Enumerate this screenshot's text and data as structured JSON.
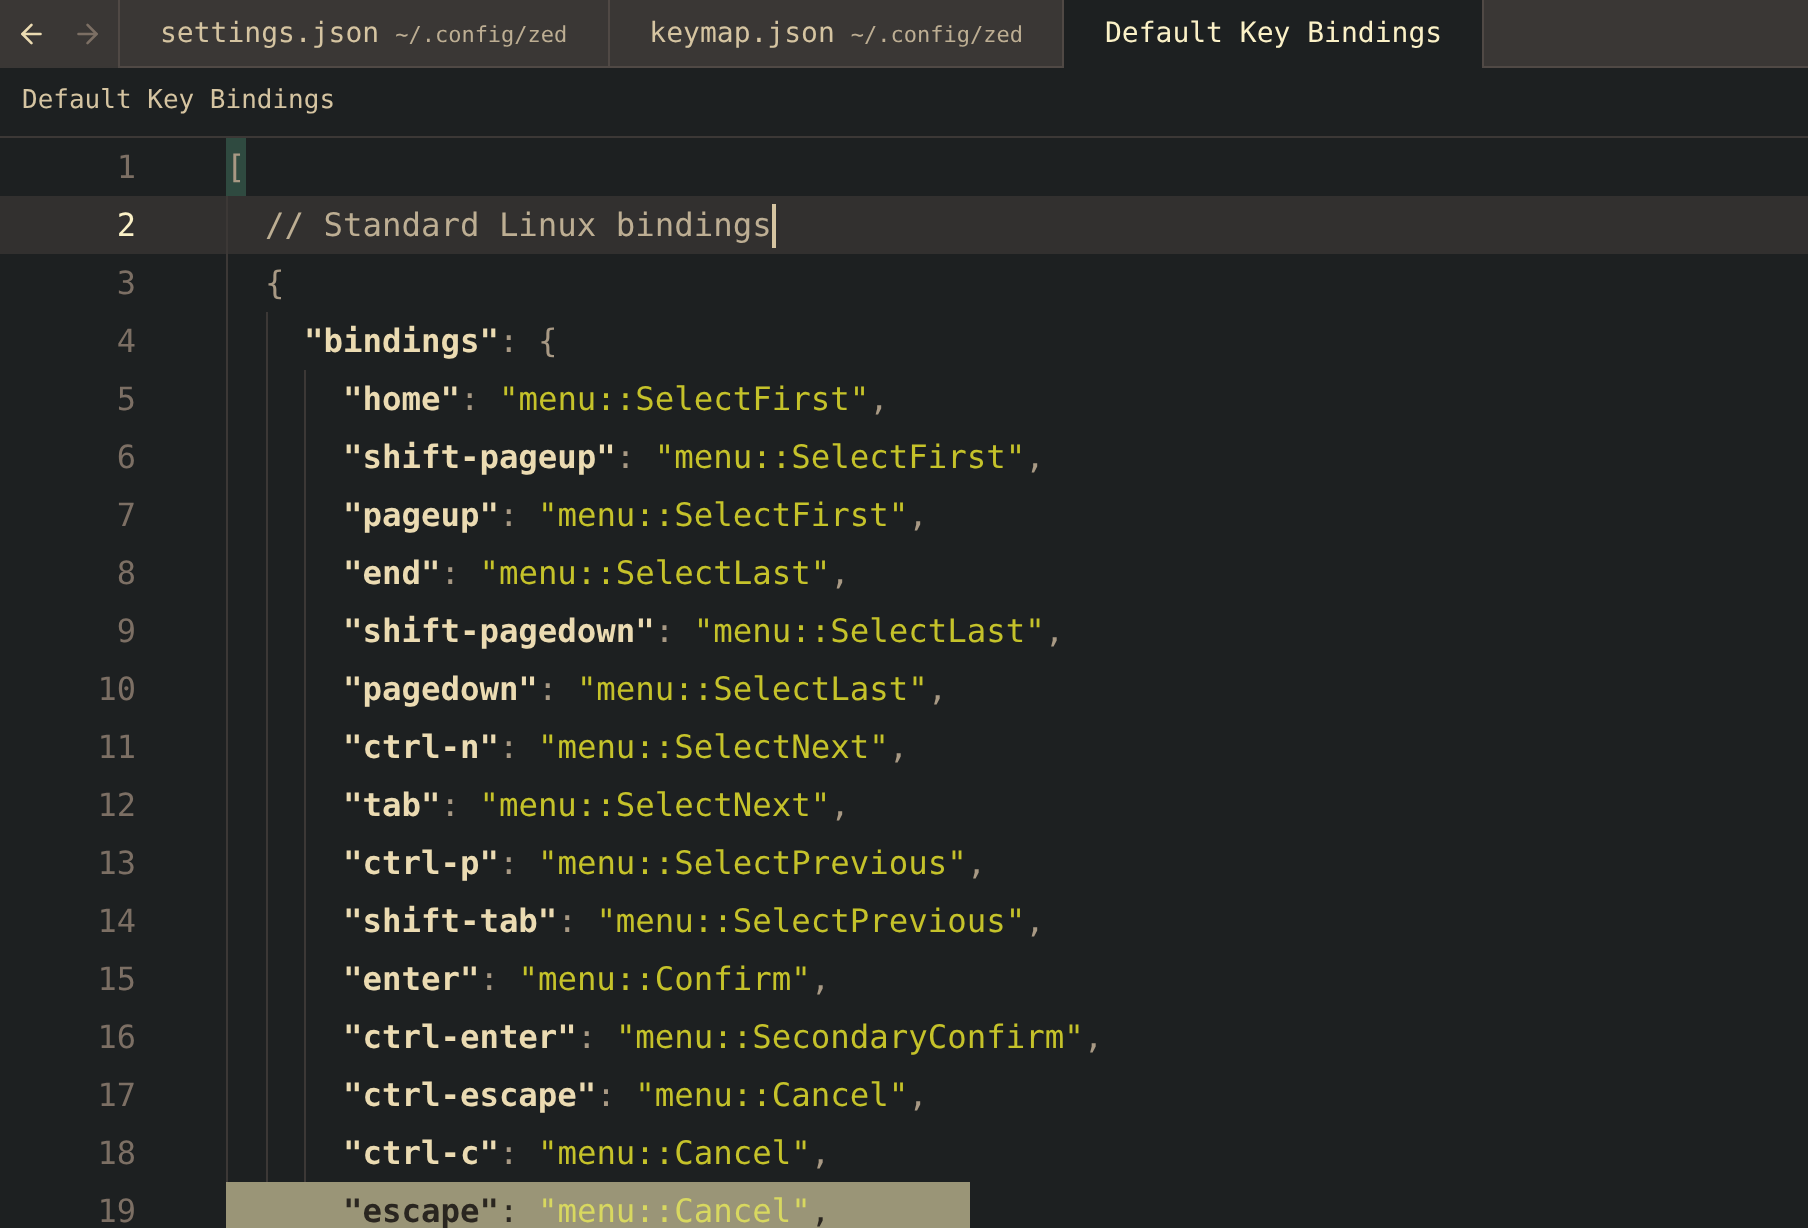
{
  "tabs": [
    {
      "title": "settings.json",
      "path": "~/.config/zed",
      "selected": false
    },
    {
      "title": "keymap.json",
      "path": "~/.config/zed",
      "selected": false
    },
    {
      "title": "Default Key Bindings",
      "selected": true
    }
  ],
  "breadcrumb": "Default Key Bindings",
  "lines": [
    {
      "number": "1",
      "current": false,
      "selected": false,
      "tokens": [
        {
          "kind": "bracket_match",
          "text": "["
        }
      ]
    },
    {
      "number": "2",
      "current": true,
      "selected": false,
      "tokens": [
        {
          "kind": "comment",
          "text": "  // Standard Linux bindings"
        }
      ]
    },
    {
      "number": "3",
      "current": false,
      "selected": false,
      "tokens": [
        {
          "kind": "punct",
          "text": "  {"
        }
      ]
    },
    {
      "number": "4",
      "current": false,
      "selected": false,
      "tokens": [
        {
          "kind": "key",
          "text": "    \"bindings\""
        },
        {
          "kind": "punct",
          "text": ": {"
        }
      ]
    },
    {
      "number": "5",
      "current": false,
      "selected": false,
      "tokens": [
        {
          "kind": "key",
          "text": "      \"home\""
        },
        {
          "kind": "punct",
          "text": ": "
        },
        {
          "kind": "string",
          "text": "\"menu::SelectFirst\""
        },
        {
          "kind": "punct",
          "text": ","
        }
      ]
    },
    {
      "number": "6",
      "current": false,
      "selected": false,
      "tokens": [
        {
          "kind": "key",
          "text": "      \"shift-pageup\""
        },
        {
          "kind": "punct",
          "text": ": "
        },
        {
          "kind": "string",
          "text": "\"menu::SelectFirst\""
        },
        {
          "kind": "punct",
          "text": ","
        }
      ]
    },
    {
      "number": "7",
      "current": false,
      "selected": false,
      "tokens": [
        {
          "kind": "key",
          "text": "      \"pageup\""
        },
        {
          "kind": "punct",
          "text": ": "
        },
        {
          "kind": "string",
          "text": "\"menu::SelectFirst\""
        },
        {
          "kind": "punct",
          "text": ","
        }
      ]
    },
    {
      "number": "8",
      "current": false,
      "selected": false,
      "tokens": [
        {
          "kind": "key",
          "text": "      \"end\""
        },
        {
          "kind": "punct",
          "text": ": "
        },
        {
          "kind": "string",
          "text": "\"menu::SelectLast\""
        },
        {
          "kind": "punct",
          "text": ","
        }
      ]
    },
    {
      "number": "9",
      "current": false,
      "selected": false,
      "tokens": [
        {
          "kind": "key",
          "text": "      \"shift-pagedown\""
        },
        {
          "kind": "punct",
          "text": ": "
        },
        {
          "kind": "string",
          "text": "\"menu::SelectLast\""
        },
        {
          "kind": "punct",
          "text": ","
        }
      ]
    },
    {
      "number": "10",
      "current": false,
      "selected": false,
      "tokens": [
        {
          "kind": "key",
          "text": "      \"pagedown\""
        },
        {
          "kind": "punct",
          "text": ": "
        },
        {
          "kind": "string",
          "text": "\"menu::SelectLast\""
        },
        {
          "kind": "punct",
          "text": ","
        }
      ]
    },
    {
      "number": "11",
      "current": false,
      "selected": false,
      "tokens": [
        {
          "kind": "key",
          "text": "      \"ctrl-n\""
        },
        {
          "kind": "punct",
          "text": ": "
        },
        {
          "kind": "string",
          "text": "\"menu::SelectNext\""
        },
        {
          "kind": "punct",
          "text": ","
        }
      ]
    },
    {
      "number": "12",
      "current": false,
      "selected": false,
      "tokens": [
        {
          "kind": "key",
          "text": "      \"tab\""
        },
        {
          "kind": "punct",
          "text": ": "
        },
        {
          "kind": "string",
          "text": "\"menu::SelectNext\""
        },
        {
          "kind": "punct",
          "text": ","
        }
      ]
    },
    {
      "number": "13",
      "current": false,
      "selected": false,
      "tokens": [
        {
          "kind": "key",
          "text": "      \"ctrl-p\""
        },
        {
          "kind": "punct",
          "text": ": "
        },
        {
          "kind": "string",
          "text": "\"menu::SelectPrevious\""
        },
        {
          "kind": "punct",
          "text": ","
        }
      ]
    },
    {
      "number": "14",
      "current": false,
      "selected": false,
      "tokens": [
        {
          "kind": "key",
          "text": "      \"shift-tab\""
        },
        {
          "kind": "punct",
          "text": ": "
        },
        {
          "kind": "string",
          "text": "\"menu::SelectPrevious\""
        },
        {
          "kind": "punct",
          "text": ","
        }
      ]
    },
    {
      "number": "15",
      "current": false,
      "selected": false,
      "tokens": [
        {
          "kind": "key",
          "text": "      \"enter\""
        },
        {
          "kind": "punct",
          "text": ": "
        },
        {
          "kind": "string",
          "text": "\"menu::Confirm\""
        },
        {
          "kind": "punct",
          "text": ","
        }
      ]
    },
    {
      "number": "16",
      "current": false,
      "selected": false,
      "tokens": [
        {
          "kind": "key",
          "text": "      \"ctrl-enter\""
        },
        {
          "kind": "punct",
          "text": ": "
        },
        {
          "kind": "string",
          "text": "\"menu::SecondaryConfirm\""
        },
        {
          "kind": "punct",
          "text": ","
        }
      ]
    },
    {
      "number": "17",
      "current": false,
      "selected": false,
      "tokens": [
        {
          "kind": "key",
          "text": "      \"ctrl-escape\""
        },
        {
          "kind": "punct",
          "text": ": "
        },
        {
          "kind": "string",
          "text": "\"menu::Cancel\""
        },
        {
          "kind": "punct",
          "text": ","
        }
      ]
    },
    {
      "number": "18",
      "current": false,
      "selected": false,
      "tokens": [
        {
          "kind": "key",
          "text": "      \"ctrl-c\""
        },
        {
          "kind": "punct",
          "text": ": "
        },
        {
          "kind": "string",
          "text": "\"menu::Cancel\""
        },
        {
          "kind": "punct",
          "text": ","
        }
      ]
    },
    {
      "number": "19",
      "current": false,
      "selected": true,
      "tokens": [
        {
          "kind": "key",
          "text": "      \"escape\""
        },
        {
          "kind": "punct",
          "text": ": "
        },
        {
          "kind": "string",
          "text": "\"menu::Cancel\""
        },
        {
          "kind": "punct",
          "text": ","
        }
      ]
    }
  ]
}
